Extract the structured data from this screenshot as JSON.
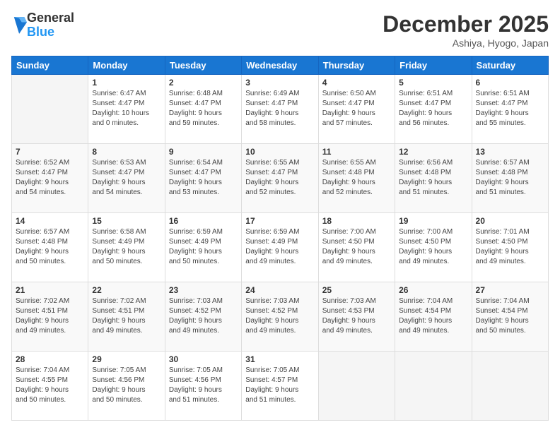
{
  "logo": {
    "general": "General",
    "blue": "Blue"
  },
  "header": {
    "month": "December 2025",
    "location": "Ashiya, Hyogo, Japan"
  },
  "weekdays": [
    "Sunday",
    "Monday",
    "Tuesday",
    "Wednesday",
    "Thursday",
    "Friday",
    "Saturday"
  ],
  "weeks": [
    [
      {
        "day": "",
        "info": ""
      },
      {
        "day": "1",
        "info": "Sunrise: 6:47 AM\nSunset: 4:47 PM\nDaylight: 10 hours\nand 0 minutes."
      },
      {
        "day": "2",
        "info": "Sunrise: 6:48 AM\nSunset: 4:47 PM\nDaylight: 9 hours\nand 59 minutes."
      },
      {
        "day": "3",
        "info": "Sunrise: 6:49 AM\nSunset: 4:47 PM\nDaylight: 9 hours\nand 58 minutes."
      },
      {
        "day": "4",
        "info": "Sunrise: 6:50 AM\nSunset: 4:47 PM\nDaylight: 9 hours\nand 57 minutes."
      },
      {
        "day": "5",
        "info": "Sunrise: 6:51 AM\nSunset: 4:47 PM\nDaylight: 9 hours\nand 56 minutes."
      },
      {
        "day": "6",
        "info": "Sunrise: 6:51 AM\nSunset: 4:47 PM\nDaylight: 9 hours\nand 55 minutes."
      }
    ],
    [
      {
        "day": "7",
        "info": "Sunrise: 6:52 AM\nSunset: 4:47 PM\nDaylight: 9 hours\nand 54 minutes."
      },
      {
        "day": "8",
        "info": "Sunrise: 6:53 AM\nSunset: 4:47 PM\nDaylight: 9 hours\nand 54 minutes."
      },
      {
        "day": "9",
        "info": "Sunrise: 6:54 AM\nSunset: 4:47 PM\nDaylight: 9 hours\nand 53 minutes."
      },
      {
        "day": "10",
        "info": "Sunrise: 6:55 AM\nSunset: 4:47 PM\nDaylight: 9 hours\nand 52 minutes."
      },
      {
        "day": "11",
        "info": "Sunrise: 6:55 AM\nSunset: 4:48 PM\nDaylight: 9 hours\nand 52 minutes."
      },
      {
        "day": "12",
        "info": "Sunrise: 6:56 AM\nSunset: 4:48 PM\nDaylight: 9 hours\nand 51 minutes."
      },
      {
        "day": "13",
        "info": "Sunrise: 6:57 AM\nSunset: 4:48 PM\nDaylight: 9 hours\nand 51 minutes."
      }
    ],
    [
      {
        "day": "14",
        "info": "Sunrise: 6:57 AM\nSunset: 4:48 PM\nDaylight: 9 hours\nand 50 minutes."
      },
      {
        "day": "15",
        "info": "Sunrise: 6:58 AM\nSunset: 4:49 PM\nDaylight: 9 hours\nand 50 minutes."
      },
      {
        "day": "16",
        "info": "Sunrise: 6:59 AM\nSunset: 4:49 PM\nDaylight: 9 hours\nand 50 minutes."
      },
      {
        "day": "17",
        "info": "Sunrise: 6:59 AM\nSunset: 4:49 PM\nDaylight: 9 hours\nand 49 minutes."
      },
      {
        "day": "18",
        "info": "Sunrise: 7:00 AM\nSunset: 4:50 PM\nDaylight: 9 hours\nand 49 minutes."
      },
      {
        "day": "19",
        "info": "Sunrise: 7:00 AM\nSunset: 4:50 PM\nDaylight: 9 hours\nand 49 minutes."
      },
      {
        "day": "20",
        "info": "Sunrise: 7:01 AM\nSunset: 4:50 PM\nDaylight: 9 hours\nand 49 minutes."
      }
    ],
    [
      {
        "day": "21",
        "info": "Sunrise: 7:02 AM\nSunset: 4:51 PM\nDaylight: 9 hours\nand 49 minutes."
      },
      {
        "day": "22",
        "info": "Sunrise: 7:02 AM\nSunset: 4:51 PM\nDaylight: 9 hours\nand 49 minutes."
      },
      {
        "day": "23",
        "info": "Sunrise: 7:03 AM\nSunset: 4:52 PM\nDaylight: 9 hours\nand 49 minutes."
      },
      {
        "day": "24",
        "info": "Sunrise: 7:03 AM\nSunset: 4:52 PM\nDaylight: 9 hours\nand 49 minutes."
      },
      {
        "day": "25",
        "info": "Sunrise: 7:03 AM\nSunset: 4:53 PM\nDaylight: 9 hours\nand 49 minutes."
      },
      {
        "day": "26",
        "info": "Sunrise: 7:04 AM\nSunset: 4:54 PM\nDaylight: 9 hours\nand 49 minutes."
      },
      {
        "day": "27",
        "info": "Sunrise: 7:04 AM\nSunset: 4:54 PM\nDaylight: 9 hours\nand 50 minutes."
      }
    ],
    [
      {
        "day": "28",
        "info": "Sunrise: 7:04 AM\nSunset: 4:55 PM\nDaylight: 9 hours\nand 50 minutes."
      },
      {
        "day": "29",
        "info": "Sunrise: 7:05 AM\nSunset: 4:56 PM\nDaylight: 9 hours\nand 50 minutes."
      },
      {
        "day": "30",
        "info": "Sunrise: 7:05 AM\nSunset: 4:56 PM\nDaylight: 9 hours\nand 51 minutes."
      },
      {
        "day": "31",
        "info": "Sunrise: 7:05 AM\nSunset: 4:57 PM\nDaylight: 9 hours\nand 51 minutes."
      },
      {
        "day": "",
        "info": ""
      },
      {
        "day": "",
        "info": ""
      },
      {
        "day": "",
        "info": ""
      }
    ]
  ]
}
